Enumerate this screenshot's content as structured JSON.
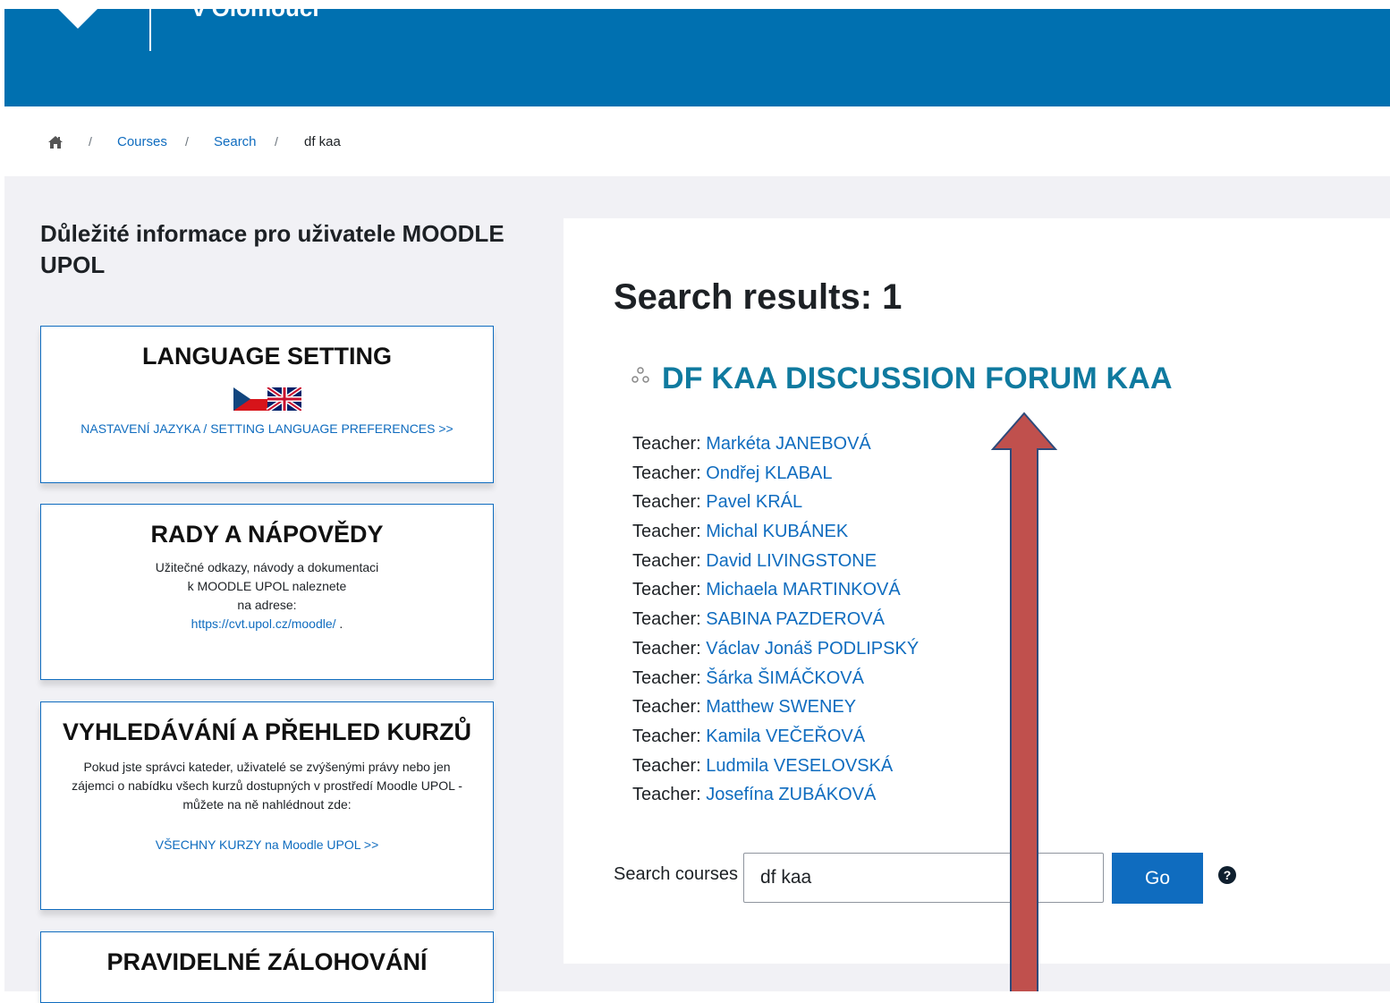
{
  "header": {
    "logo_text": "v Olomouci"
  },
  "breadcrumb": {
    "items": [
      {
        "label": "Courses",
        "link": true
      },
      {
        "label": "Search",
        "link": true
      },
      {
        "label": "df kaa",
        "link": false
      }
    ],
    "separator": "/"
  },
  "sidebar": {
    "title": "Důležité informace pro uživatele MOODLE UPOL",
    "boxes": [
      {
        "title": "LANGUAGE SETTING",
        "link": "NASTAVENÍ JAZYKA / SETTING LANGUAGE PREFERENCES >>"
      },
      {
        "title": "RADY A NÁPOVĚDY",
        "text_lines": [
          "Užitečné odkazy, návody a dokumentaci",
          "k MOODLE UPOL naleznete",
          "na adrese:"
        ],
        "link": "https://cvt.upol.cz/moodle/",
        "link_suffix": " ."
      },
      {
        "title": "VYHLEDÁVÁNÍ A PŘEHLED KURZŮ",
        "text_lines": [
          "Pokud jste správci kateder, uživatelé se zvýšenými právy nebo jen",
          "zájemci o nabídku všech kurzů dostupných v prostředí Moodle UPOL -",
          "můžete na ně nahlédnout zde:"
        ],
        "link": "VŠECHNY KURZY na Moodle UPOL  >>"
      },
      {
        "title": "PRAVIDELNÉ ZÁLOHOVÁNÍ"
      }
    ]
  },
  "main": {
    "results_title": "Search results: 1",
    "course_title": "DF KAA DISCUSSION FORUM KAA",
    "teacher_role": "Teacher: ",
    "teachers": [
      "Markéta JANEBOVÁ",
      "Ondřej KLABAL",
      "Pavel KRÁL",
      "Michal KUBÁNEK",
      "David LIVINGSTONE",
      "Michaela MARTINKOVÁ",
      "SABINA PAZDEROVÁ",
      "Václav Jonáš PODLIPSKÝ",
      "Šárka ŠIMÁČKOVÁ",
      "Matthew SWENEY",
      "Kamila VEČEŘOVÁ",
      "Ludmila VESELOVSKÁ",
      "Josefína ZUBÁKOVÁ"
    ],
    "search": {
      "label": "Search courses",
      "value": "df kaa",
      "button": "Go",
      "help": "?"
    }
  },
  "annotation": {
    "arrow_fill": "#c0504d",
    "arrow_stroke": "#2e4a7a"
  },
  "colors": {
    "header": "#0070b0",
    "link": "#0f6cbf",
    "course_title": "#0f7a9f"
  }
}
